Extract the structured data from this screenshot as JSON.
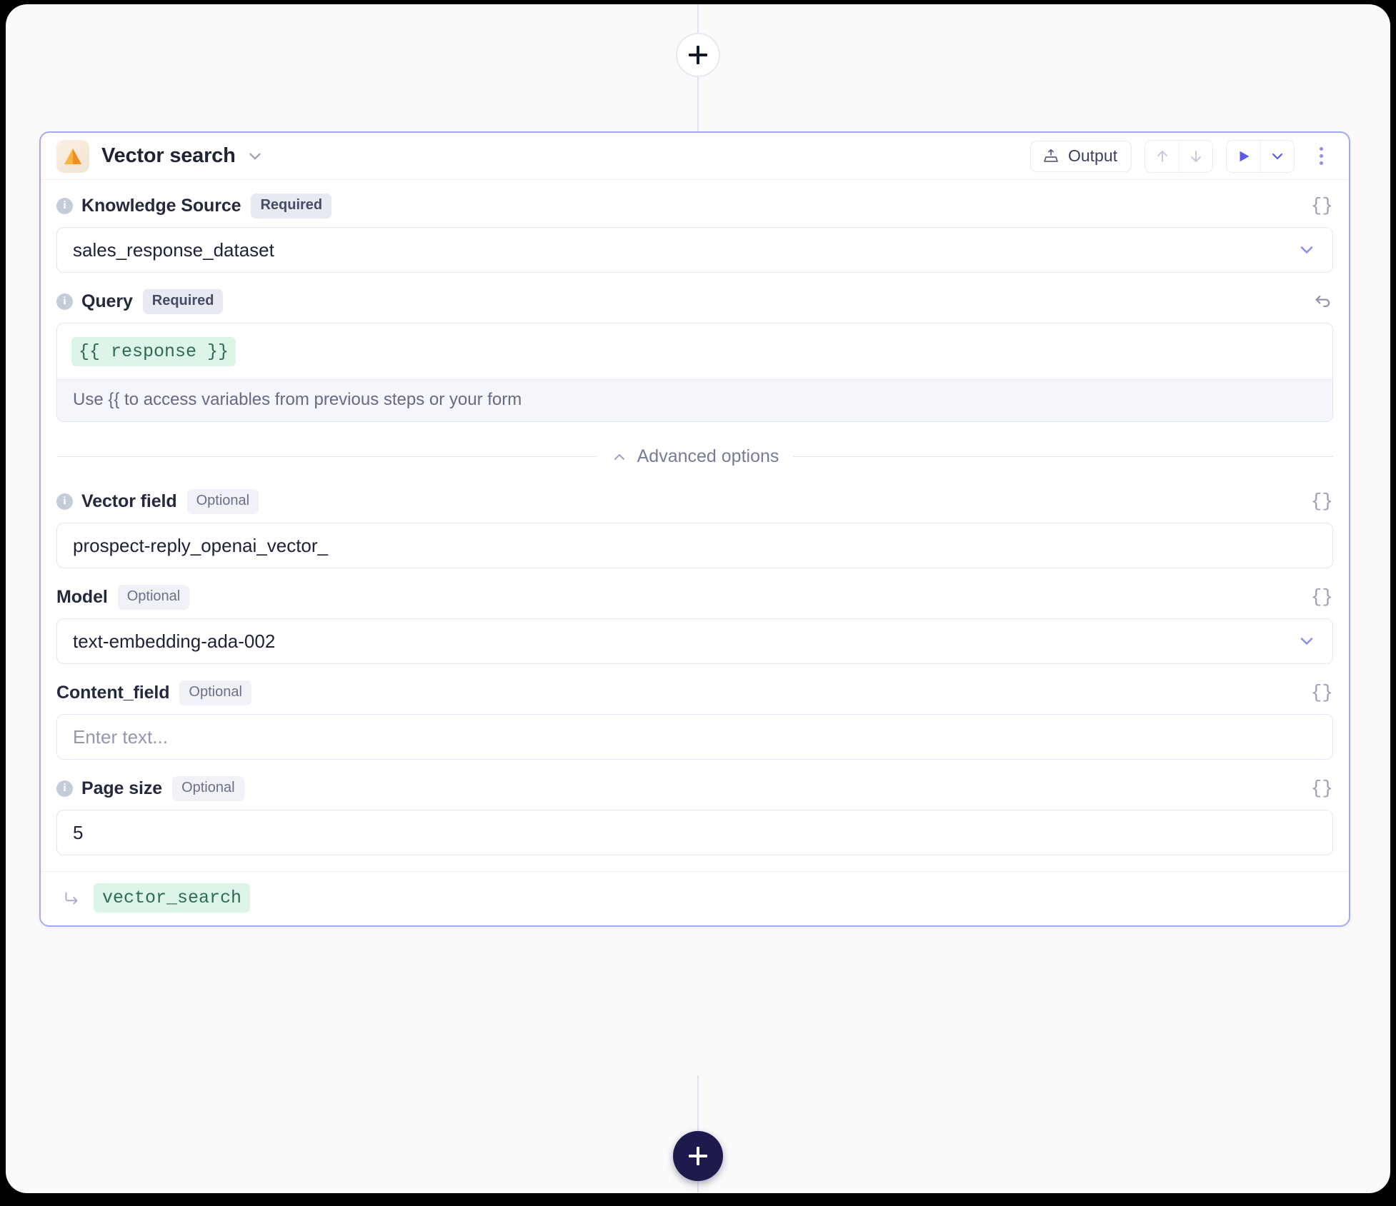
{
  "flow": {
    "add_step_top_label": "+",
    "add_step_bottom_label": "+"
  },
  "node": {
    "title": "Vector search",
    "app_icon": "orange-pyramid-icon",
    "toolbar": {
      "output_label": "Output",
      "output_icon": "export-tray-icon",
      "move_up_icon": "arrow-up-icon",
      "move_down_icon": "arrow-down-icon",
      "run_icon": "play-icon",
      "run_options_icon": "chevron-down-icon",
      "more_icon": "kebab-menu-icon"
    },
    "fields": [
      {
        "key": "knowledge_source",
        "label": "Knowledge Source",
        "badge": "Required",
        "has_info": true,
        "control": "select",
        "value": "sales_response_dataset",
        "right_icon": "braces-icon",
        "right_icon_text": "{}"
      },
      {
        "key": "query",
        "label": "Query",
        "badge": "Required",
        "has_info": true,
        "control": "code",
        "token": "{{ response }}",
        "hint": "Use {{ to access variables from previous steps or your form",
        "right_icon": "undo-icon"
      },
      {
        "key": "vector_field",
        "label": "Vector field",
        "badge": "Optional",
        "has_info": true,
        "control": "text",
        "value": "prospect-reply_openai_vector_",
        "right_icon": "braces-icon",
        "right_icon_text": "{}"
      },
      {
        "key": "model",
        "label": "Model",
        "badge": "Optional",
        "has_info": false,
        "control": "select",
        "value": "text-embedding-ada-002",
        "right_icon": "braces-icon",
        "right_icon_text": "{}"
      },
      {
        "key": "content_field",
        "label": "Content_field",
        "badge": "Optional",
        "has_info": false,
        "control": "text",
        "value": "",
        "placeholder": "Enter text...",
        "right_icon": "braces-icon",
        "right_icon_text": "{}"
      },
      {
        "key": "page_size",
        "label": "Page size",
        "badge": "Optional",
        "has_info": true,
        "control": "text",
        "value": "5",
        "right_icon": "braces-icon",
        "right_icon_text": "{}"
      }
    ],
    "advanced": {
      "label": "Advanced options",
      "icon": "chevron-up-icon",
      "expanded": true
    },
    "footer": {
      "arrow_icon": "arrow-turn-down-right-icon",
      "output_variable": "vector_search"
    }
  },
  "colors": {
    "accent": "#5b5bea",
    "card_border": "#a5a9f0",
    "token_text": "#2f6b52",
    "token_bg": "#dcf5e6",
    "canvas_bg": "#fafafb",
    "app_icon_orange": "#f3a43a"
  }
}
